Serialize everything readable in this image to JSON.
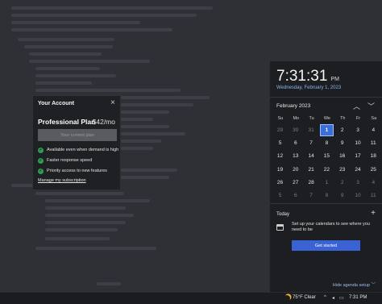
{
  "account": {
    "title": "Your Account",
    "close_icon": "×",
    "plan_name": "Professional Plan",
    "plan_price": "$42/mo",
    "current_plan_label": "Your current plan",
    "features": [
      "Available even when demand is high",
      "Faster response speed",
      "Priority access to new features"
    ],
    "manage_link": "Manage my subscription"
  },
  "clock": {
    "time": "7:31:31",
    "ampm": "PM",
    "date": "Wednesday, February 1, 2023"
  },
  "calendar": {
    "month_label": "February 2023",
    "prev_icon": "︿",
    "next_icon": "﹀",
    "weekdays": [
      "Su",
      "Mo",
      "Tu",
      "We",
      "Th",
      "Fr",
      "Sa"
    ],
    "weeks": [
      [
        "29",
        "30",
        "31",
        "1",
        "2",
        "3",
        "4"
      ],
      [
        "5",
        "6",
        "7",
        "8",
        "9",
        "10",
        "11"
      ],
      [
        "12",
        "13",
        "14",
        "15",
        "16",
        "17",
        "18"
      ],
      [
        "19",
        "20",
        "21",
        "22",
        "23",
        "24",
        "25"
      ],
      [
        "26",
        "27",
        "28",
        "1",
        "2",
        "3",
        "4"
      ],
      [
        "5",
        "6",
        "7",
        "8",
        "9",
        "10",
        "11"
      ]
    ],
    "today": "1"
  },
  "agenda": {
    "today_label": "Today",
    "add_icon": "+",
    "setup_text": "Set up your calendars to see where you need to be",
    "get_started_label": "Get started",
    "hide_label": "Hide agenda setup ﹀"
  },
  "taskbar": {
    "weather": "75°F  Clear",
    "caret": "^",
    "time": "7:31 PM"
  },
  "colors": {
    "accent": "#3a62d3",
    "today_highlight": "#3b6ed8",
    "check_green": "#2e9e55",
    "weather_icon": "#f2b531"
  }
}
